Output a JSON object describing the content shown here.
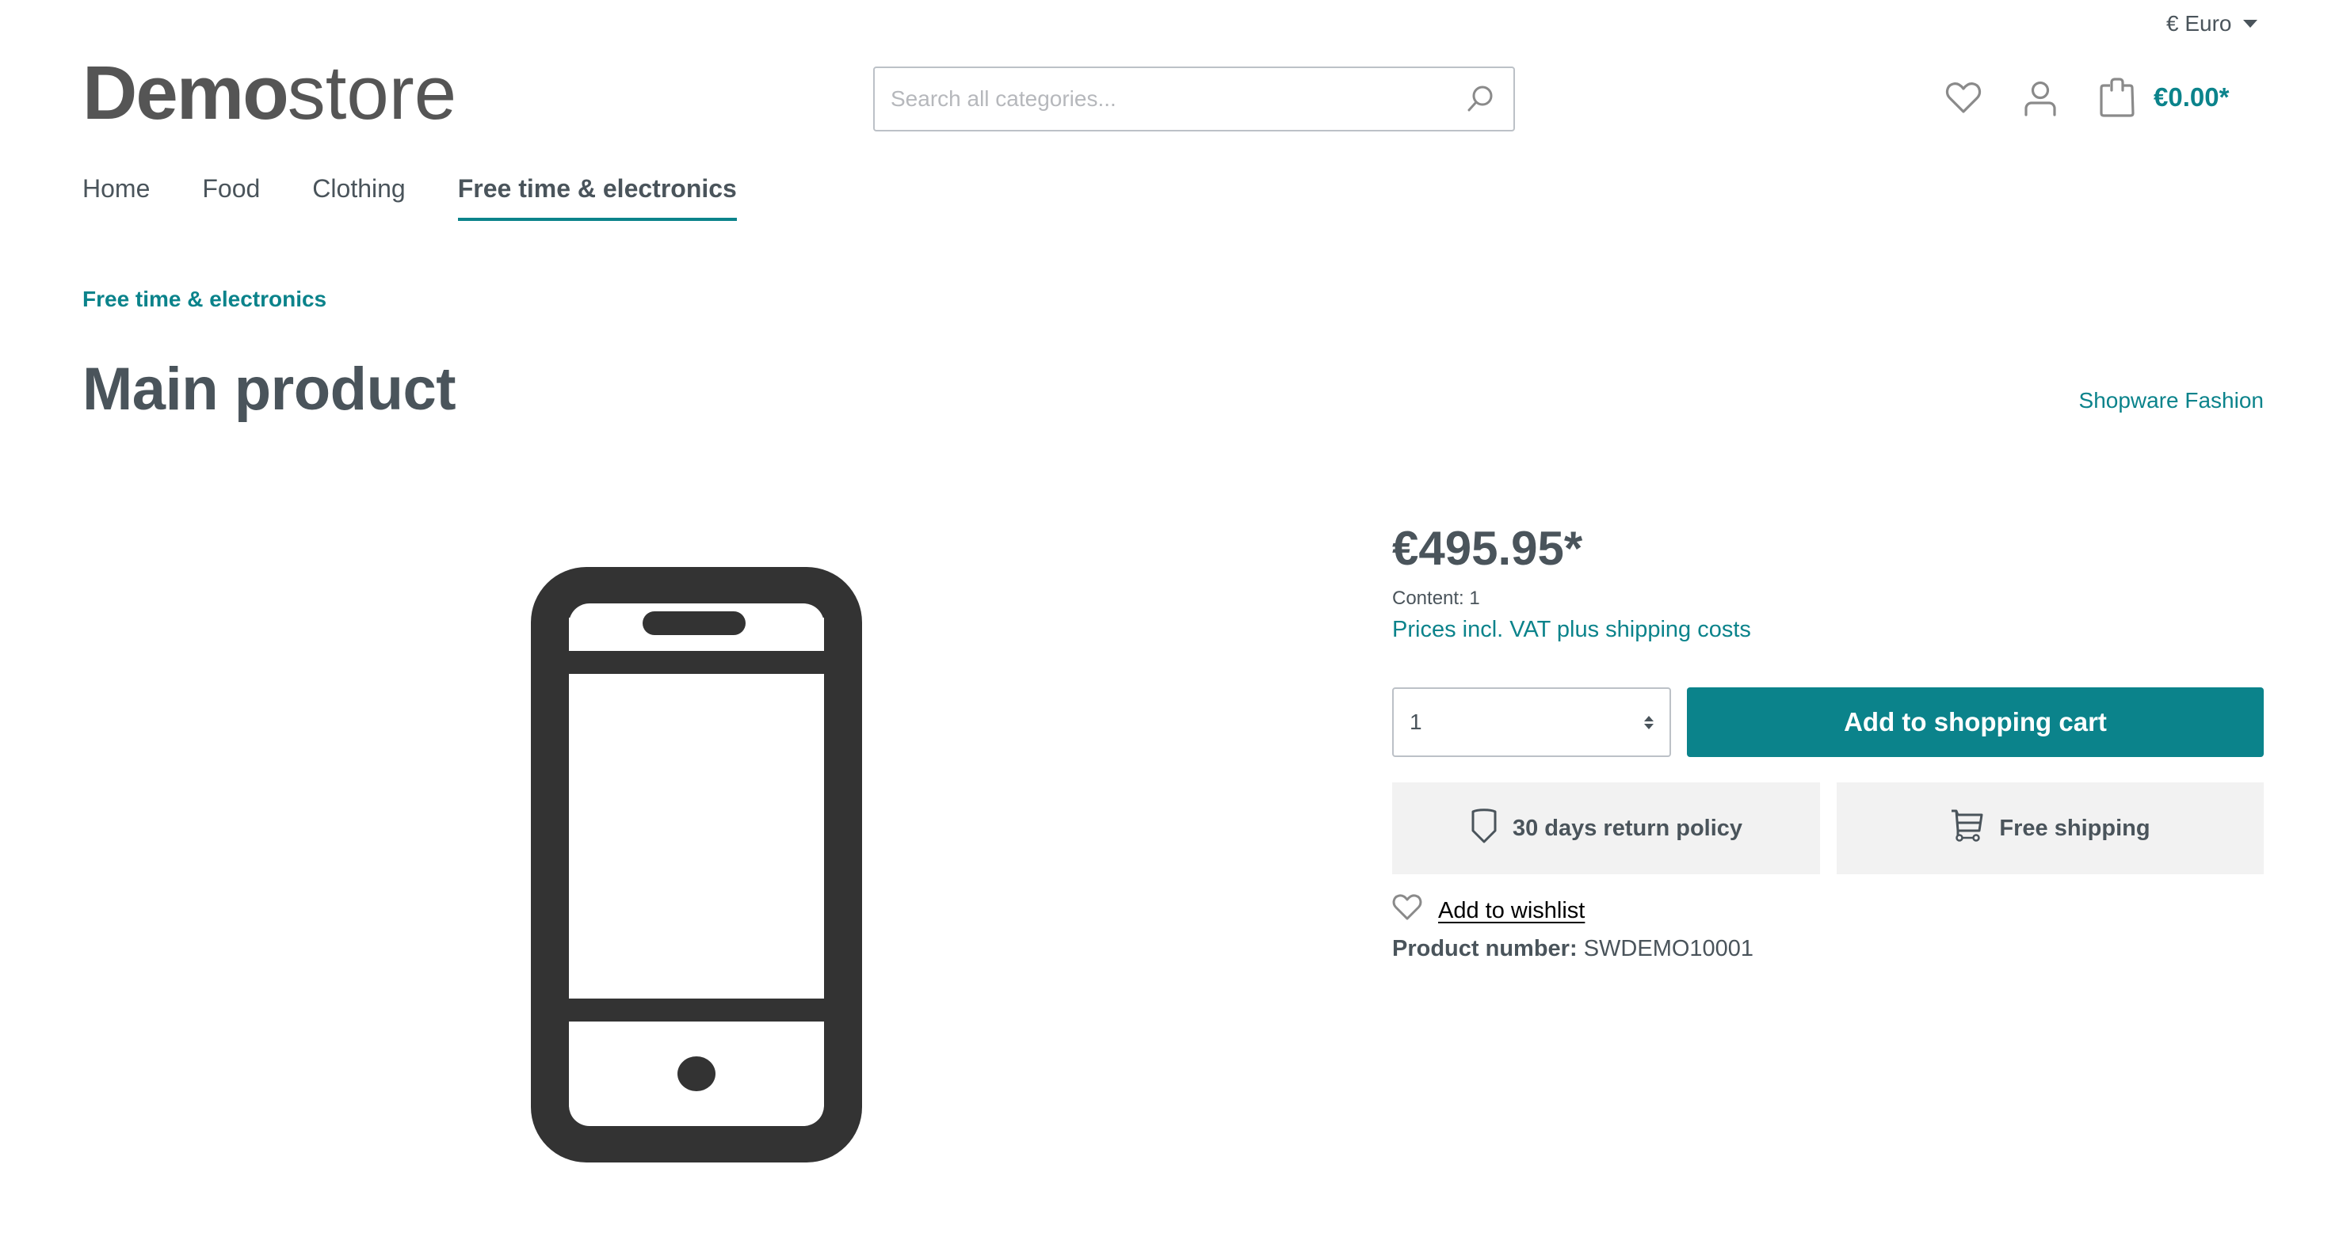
{
  "header": {
    "currency": {
      "symbol": "€",
      "label": "Euro",
      "display": "€ Euro"
    },
    "logo": {
      "bold": "Demo",
      "light": "store"
    },
    "search": {
      "placeholder": "Search all categories...",
      "value": ""
    },
    "icons": {
      "wishlist": "heart-icon",
      "account": "user-icon",
      "cart": "shopping-bag-icon",
      "search": "search-icon"
    },
    "cart_total": "€0.00*"
  },
  "nav": {
    "items": [
      {
        "label": "Home",
        "active": false
      },
      {
        "label": "Food",
        "active": false
      },
      {
        "label": "Clothing",
        "active": false
      },
      {
        "label": "Free time & electronics",
        "active": true
      }
    ]
  },
  "breadcrumb": {
    "items": [
      "Free time & electronics"
    ]
  },
  "product": {
    "title": "Main product",
    "manufacturer": "Shopware Fashion",
    "image_icon": "smartphone-icon",
    "price": "€495.95*",
    "content": "Content: 1",
    "vat_note": "Prices incl. VAT plus shipping costs",
    "quantity": "1",
    "add_to_cart_label": "Add to shopping cart",
    "perks": [
      {
        "icon": "shield-icon",
        "label": "30 days return policy"
      },
      {
        "icon": "cart-icon",
        "label": "Free shipping"
      }
    ],
    "wishlist_label": "Add to wishlist",
    "product_number_label": "Product number:",
    "product_number": "SWDEMO10001"
  },
  "colors": {
    "accent": "#0b838b",
    "text": "#4a545b",
    "icon": "#8a8a8a",
    "perk_background": "#f2f2f2",
    "border": "#bcc1c7"
  }
}
